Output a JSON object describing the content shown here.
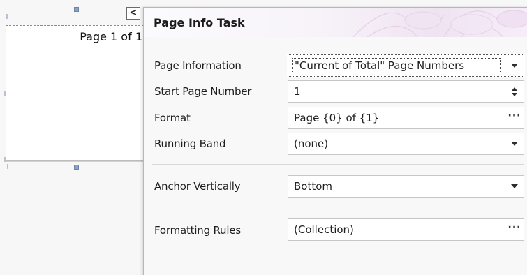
{
  "designer": {
    "control_text": "Page 1 of 1",
    "smart_tag_glyph": "<"
  },
  "panel": {
    "title": "Page Info Task",
    "accent_color": "#efe3f1",
    "rows": [
      {
        "label": "Page Information",
        "value": "\"Current of Total\" Page Numbers",
        "editor": "dropdown"
      },
      {
        "label": "Start Page Number",
        "value": "1",
        "editor": "spinner"
      },
      {
        "label": "Format",
        "value": "Page {0} of {1}",
        "editor": "ellipsis"
      },
      {
        "label": "Running Band",
        "value": "(none)",
        "editor": "dropdown"
      },
      {
        "label": "Anchor Vertically",
        "value": "Bottom",
        "editor": "dropdown"
      },
      {
        "label": "Formatting Rules",
        "value": "(Collection)",
        "editor": "ellipsis"
      }
    ],
    "ellipsis_glyph": "···"
  }
}
